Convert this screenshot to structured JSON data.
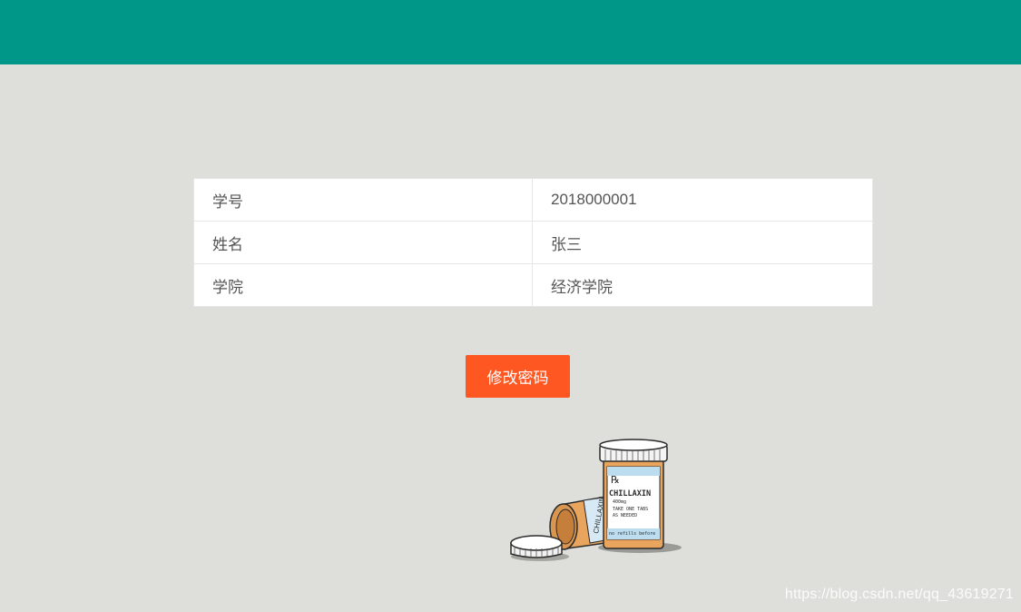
{
  "header": {
    "color": "#009688"
  },
  "profile": {
    "rows": [
      {
        "label": "学号",
        "value": "2018000001"
      },
      {
        "label": "姓名",
        "value": "张三"
      },
      {
        "label": "学院",
        "value": "经济学院"
      }
    ]
  },
  "actions": {
    "change_password_label": "修改密码",
    "button_color": "#ff5722"
  },
  "illustration": {
    "icon": "pill-bottles-icon",
    "bottle_label": "CHILLAXIN",
    "dose": "400mg",
    "instructions_line1": "TAKE ONE TABS",
    "instructions_line2": "AS NEEDED",
    "refills": "no refills before",
    "rx": "℞",
    "tipped_bottle_label": "CHILLAXIN"
  },
  "watermark": "https://blog.csdn.net/qq_43619271"
}
